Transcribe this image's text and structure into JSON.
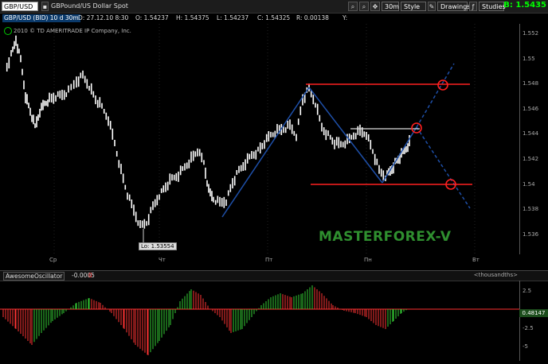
{
  "toolbar": {
    "symbol": "GBP/USD",
    "description": "GBPound/US Dollar Spot",
    "timeframe": "30m",
    "style_label": "Style",
    "drawings_label": "Drawings",
    "studies_label": "Studies",
    "last_price": "B: 1.5435"
  },
  "quote": {
    "instrument": "GBP/USD (BID) 10 d 30m",
    "date": "D: 27.12.10 8:30",
    "open": "O: 1.54237",
    "high": "H: 1.54375",
    "low": "L: 1.54237",
    "close": "C: 1.54325",
    "range": "R: 0.00138",
    "volume": "Y:"
  },
  "copyright": "2010 © TD AMERITRADE IP Company, Inc.",
  "watermark": "MASTERFOREX-V",
  "low_label": "Lo: 1.53554",
  "y_axis": [
    "1.552",
    "1.55",
    "1.548",
    "1.546",
    "1.544",
    "1.542",
    "1.54",
    "1.538",
    "1.536"
  ],
  "x_axis": [
    "Ср",
    "Чт",
    "Пт",
    "Пн",
    "Вт"
  ],
  "indicator": {
    "name": "AwesomeOscillator",
    "value": "-0.0005",
    "flag": "0",
    "units": "<thousandths>",
    "axis": [
      "2.5",
      "-2.5",
      "-5"
    ],
    "current": "0.48147"
  },
  "colors": {
    "candle": "#ffffff",
    "trendline": "#1e4fa8",
    "level": "#ff2020",
    "ao_up": "#33cc33",
    "ao_down": "#ff3333"
  }
}
